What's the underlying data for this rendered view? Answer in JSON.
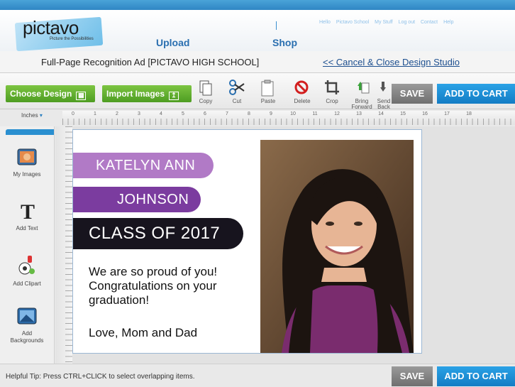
{
  "header": {
    "logo_text": "pictavo",
    "logo_tagline": "Picture the Possibilities",
    "nav_upload": "Upload",
    "nav_shop": "Shop",
    "top_links": [
      "Hello",
      "Pictavo School",
      "My Stuff",
      "Log out",
      "Contact",
      "Help"
    ]
  },
  "titlebar": {
    "document_title": "Full-Page Recognition Ad [PICTAVO HIGH SCHOOL]",
    "cancel_link": "<< Cancel & Close Design Studio"
  },
  "toolbar": {
    "choose_design": "Choose Design",
    "import_images": "Import Images",
    "tools": [
      {
        "label": "Copy",
        "icon": "copy-icon"
      },
      {
        "label": "Cut",
        "icon": "scissors-icon"
      },
      {
        "label": "Paste",
        "icon": "paste-icon"
      },
      {
        "label": "Delete",
        "icon": "delete-icon"
      },
      {
        "label": "Crop",
        "icon": "crop-icon"
      },
      {
        "label": "Bring Forward",
        "icon": "bring-forward-icon"
      },
      {
        "label": "Send Back",
        "icon": "send-back-icon"
      }
    ],
    "save": "SAVE",
    "add_to_cart": "ADD TO CART"
  },
  "ruler": {
    "units": "Inches",
    "ticks": [
      "0",
      "1",
      "2",
      "3",
      "4",
      "5",
      "6",
      "7",
      "8",
      "9",
      "10",
      "11",
      "12",
      "13",
      "14",
      "15",
      "16",
      "17",
      "18"
    ]
  },
  "sidebar": {
    "items": [
      {
        "label": "My Images",
        "icon": "my-images-icon"
      },
      {
        "label": "Add Text",
        "icon": "add-text-icon"
      },
      {
        "label": "Add Clipart",
        "icon": "clipart-icon"
      },
      {
        "label": "Add Backgrounds",
        "icon": "backgrounds-icon"
      }
    ]
  },
  "design": {
    "first_name": "KATELYN ANN",
    "last_name": "JOHNSON",
    "class_line": "CLASS OF 2017",
    "message_lines": [
      "We are so proud of you!",
      "Congratulations on your",
      "graduation!"
    ],
    "signature": "Love, Mom and Dad",
    "colors": {
      "banner1": "#b17ac6",
      "banner2": "#7b3c9f",
      "banner3": "#17141e"
    }
  },
  "footer": {
    "tip": "Helpful Tip: Press CTRL+CLICK to select overlapping items.",
    "save": "SAVE",
    "add_to_cart": "ADD TO CART"
  },
  "colors": {
    "accent_blue": "#1a8ad6",
    "green_button": "#5aa82c"
  }
}
